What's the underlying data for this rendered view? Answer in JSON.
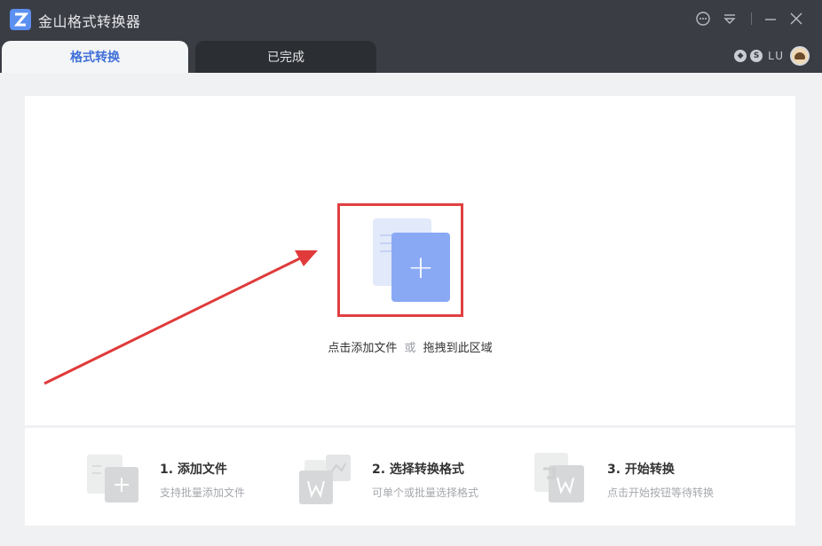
{
  "app": {
    "title": "金山格式转换器",
    "icons": [
      "app-logo-icon",
      "feedback-icon",
      "menu-icon",
      "minimize-icon",
      "close-icon"
    ]
  },
  "tabs": [
    {
      "label": "格式转换",
      "active": true
    },
    {
      "label": "已完成",
      "active": false
    }
  ],
  "user": {
    "name": "LU",
    "badges": [
      "vip-icon",
      "s-badge-icon"
    ]
  },
  "dropzone": {
    "action_label": "点击添加文件",
    "or_label": "或",
    "drag_label": "拖拽到此区域",
    "highlight_color": "#e04040"
  },
  "steps": [
    {
      "title": "1. 添加文件",
      "desc": "支持批量添加文件",
      "icon": "add-file-icon"
    },
    {
      "title": "2. 选择转换格式",
      "desc": "可单个或批量选择格式",
      "icon": "select-format-icon"
    },
    {
      "title": "3. 开始转换",
      "desc": "点击开始按钮等待转换",
      "icon": "start-convert-icon"
    }
  ],
  "colors": {
    "accent": "#3f6fd8",
    "titlebar": "#3a3d44",
    "add_icon": "#8aa9f5"
  }
}
